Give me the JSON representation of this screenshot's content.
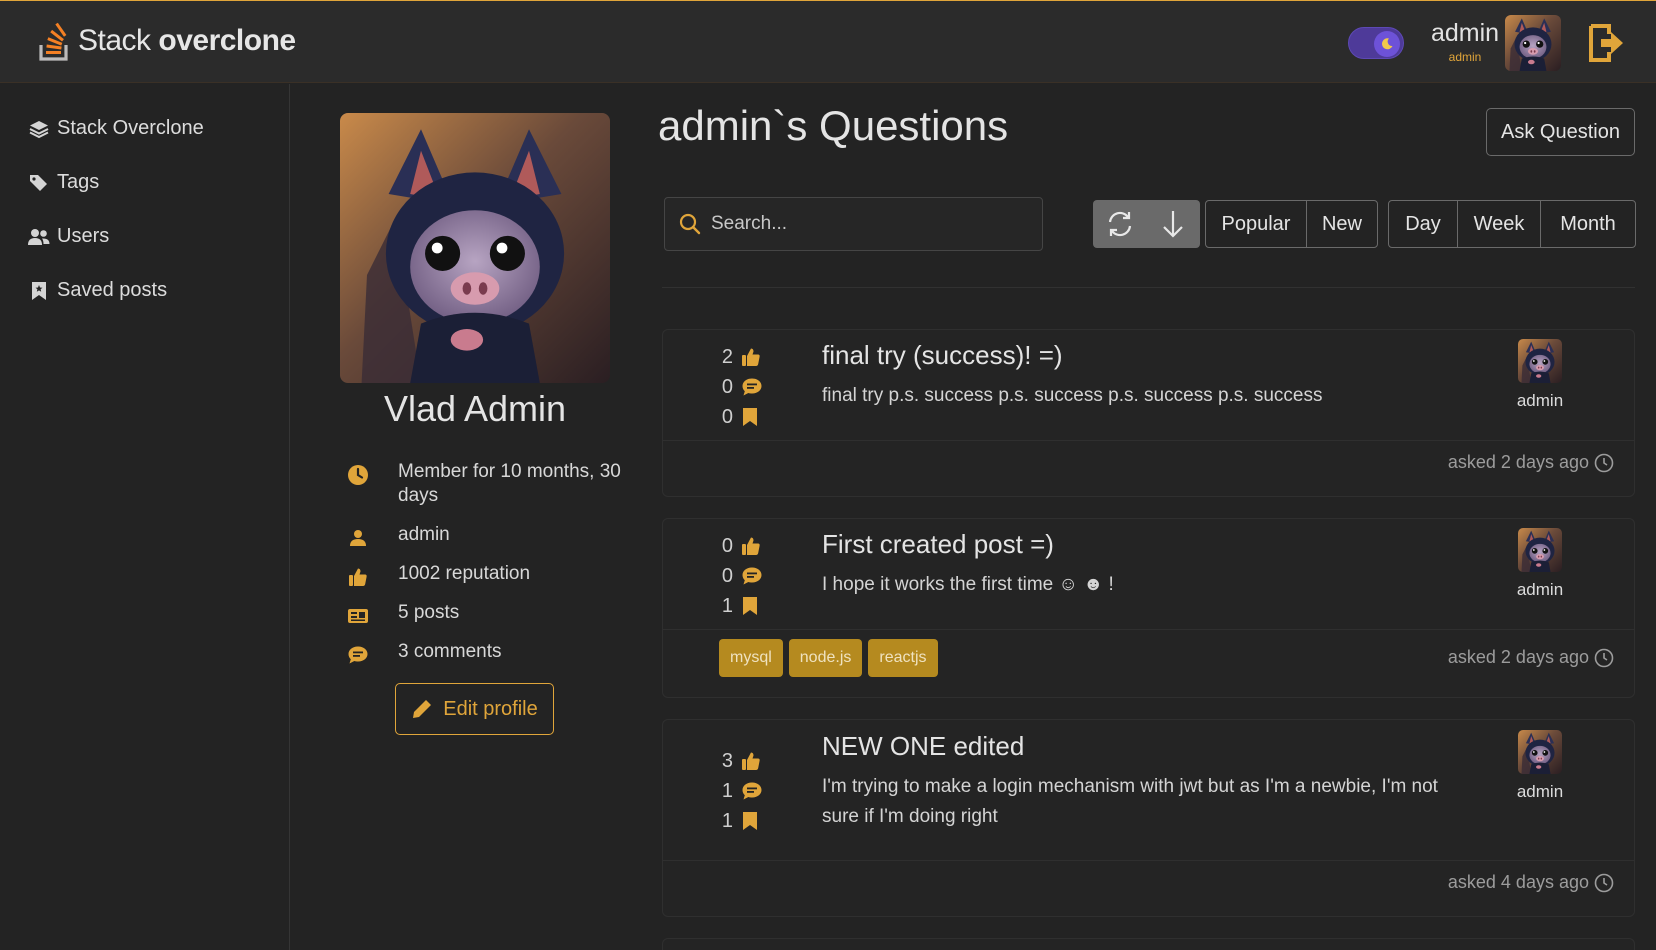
{
  "header": {
    "logo_light": "Stack ",
    "logo_bold": "overclone",
    "user_name": "admin",
    "user_role": "admin",
    "theme_icon": "moon-icon",
    "logout_icon": "logout-icon"
  },
  "sidebar": {
    "items": [
      {
        "label": "Stack Overclone",
        "icon": "layers-icon"
      },
      {
        "label": "Tags",
        "icon": "tags-icon"
      },
      {
        "label": "Users",
        "icon": "users-icon"
      },
      {
        "label": "Saved posts",
        "icon": "bookmark-icon"
      }
    ]
  },
  "profile": {
    "name": "Vlad Admin",
    "member_for": "Member for 10 months, 30 days",
    "username": "admin",
    "reputation": "1002 reputation",
    "posts": "5 posts",
    "comments": "3 comments",
    "edit_label": "Edit profile"
  },
  "main": {
    "title": "admin`s Questions",
    "ask_label": "Ask Question",
    "search_placeholder": "Search...",
    "sort_buttons": [
      "Popular",
      "New"
    ],
    "period_buttons": [
      "Day",
      "Week",
      "Month"
    ]
  },
  "questions": [
    {
      "likes": "2",
      "comments": "0",
      "saves": "0",
      "title": "final try (success)! =)",
      "body": "final try p.s. success p.s. success p.s. success p.s. success",
      "author": "admin",
      "asked": "asked 2 days ago",
      "tags": []
    },
    {
      "likes": "0",
      "comments": "0",
      "saves": "1",
      "title": "First created post =)",
      "body": "I hope it works the first time ☺ ☻ !",
      "author": "admin",
      "asked": "asked 2 days ago",
      "tags": [
        "mysql",
        "node.js",
        "reactjs"
      ]
    },
    {
      "likes": "3",
      "comments": "1",
      "saves": "1",
      "title": "NEW ONE edited",
      "body": "I'm trying to make a login mechanism with jwt but as I'm a newbie, I'm not sure if I'm doing right",
      "author": "admin",
      "asked": "asked 4 days ago",
      "tags": []
    }
  ],
  "colors": {
    "accent": "#e0a53a",
    "background": "#232323",
    "header": "#2b2b2b",
    "tag_bg": "#b58a1f",
    "toggle": "#4e3a99"
  }
}
